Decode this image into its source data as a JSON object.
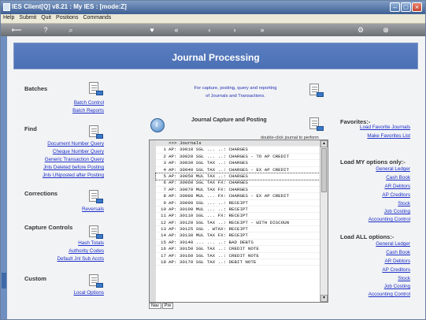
{
  "window": {
    "title": "IES Client[Q] v8.21 : My IES :         [mode:Z]"
  },
  "menu": [
    "Help",
    "Submit",
    "Quit",
    "Positions",
    "Commands"
  ],
  "toolbar": {
    "icons": [
      "arrow-left-icon",
      "help-icon",
      "search-icon",
      "heart-icon",
      "back-icon",
      "prev-icon",
      "next-icon",
      "forward-icon",
      "options-icon",
      "close-icon"
    ]
  },
  "banner": {
    "title": "Journal Processing"
  },
  "left": {
    "batches": {
      "heading": "Batches",
      "links": [
        "Batch Control",
        "Batch Reports"
      ]
    },
    "find": {
      "heading": "Find",
      "links": [
        "Document Number Query",
        "Cheque Number Query",
        "Generic Transaction Query",
        "Jnls Deleted before Posting",
        "Jnls UNposted after Posting"
      ]
    },
    "corrections": {
      "heading": "Corrections",
      "links": [
        "Reversals"
      ]
    },
    "capture_controls": {
      "heading": "Capture Controls",
      "links": [
        "Hash Totals",
        "Authority Codes",
        "Default Jnl Sub Accts"
      ]
    },
    "custom": {
      "heading": "Custom",
      "links": [
        "Local Options"
      ]
    }
  },
  "center": {
    "hint_line1": "For capture, posting, query and reporting",
    "hint_line2": "of Journals and Transactions.",
    "capture_title": "Journal Capture and Posting",
    "dbl_hint": "double-click journal to perform",
    "list_header": ">>> Journals",
    "rows": [
      {
        "n": "1",
        "text": "AP: 30010 SGL ... ..: CHARGES"
      },
      {
        "n": "2",
        "text": "AP: 30020 SGL ... ..: CHARGES - TO AP CREDIT"
      },
      {
        "n": "3",
        "text": "AP: 30030 SGL TAX ..: CHARGES"
      },
      {
        "n": "4",
        "text": "AP: 30040 SGL TAX ..: CHARGES - EX AP CREDIT"
      },
      {
        "n": "5",
        "text": "AP: 30050 MUL TAX ..: CHARGES"
      },
      {
        "n": "6",
        "text": "AP: 30060 SGL TAX FX: CHARGES"
      },
      {
        "n": "7",
        "text": "AP: 30070 MUL TAX FX: CHARGES"
      },
      {
        "n": "8",
        "text": "AP: 30080 MUL ... FX: CHARGES - EX AP CREDIT"
      },
      {
        "n": "9",
        "text": "AP: 30090 SGL ... ..: RECEIPT"
      },
      {
        "n": "10",
        "text": "AP: 30100 MUL ... ..: RECEIPT"
      },
      {
        "n": "11",
        "text": "AP: 30110 SGL ... FX: RECEIPT"
      },
      {
        "n": "12",
        "text": "AP: 30120 SGL TAX ..: RECEIPT - WITH DISCOUN"
      },
      {
        "n": "13",
        "text": "AP: 30125 SGL . WTAX: RECEIPT"
      },
      {
        "n": "14",
        "text": "AP: 30130 MUL TAX FX: RECEIPT"
      },
      {
        "n": "15",
        "text": "AP: 30140 ... ... ..: BAD DEBTS"
      },
      {
        "n": "16",
        "text": "AP: 30150 SGL TAX ..: CREDIT NOTE"
      },
      {
        "n": "17",
        "text": "AP: 30160 SGL TAX ..: CREDIT NOTE"
      },
      {
        "n": "18",
        "text": "AP: 30170 SGL TAX ..: DEBIT NOTE"
      }
    ],
    "tabs": [
      "Nav",
      "Pre"
    ]
  },
  "right": {
    "favorites": {
      "heading": "Favorites:-",
      "links": [
        "Load Favorite Journals",
        "Make Favorites List"
      ]
    },
    "my_options": {
      "heading": "Load MY options only:-",
      "links": [
        "General Ledger",
        "Cash Book",
        "AR Debtors",
        "AP Creditors",
        "Stock",
        "Job Costing",
        "Accounting Control"
      ]
    },
    "all_options": {
      "heading": "Load ALL options:-",
      "links": [
        "General Ledger",
        "Cash Book",
        "AR Debtors",
        "AP Creditors",
        "Stock",
        "Job Costing",
        "Accounting Control"
      ]
    }
  },
  "colors": {
    "banner": "#4b70b4",
    "link": "#1a2dc8",
    "titlebar": "#3d5f93"
  }
}
